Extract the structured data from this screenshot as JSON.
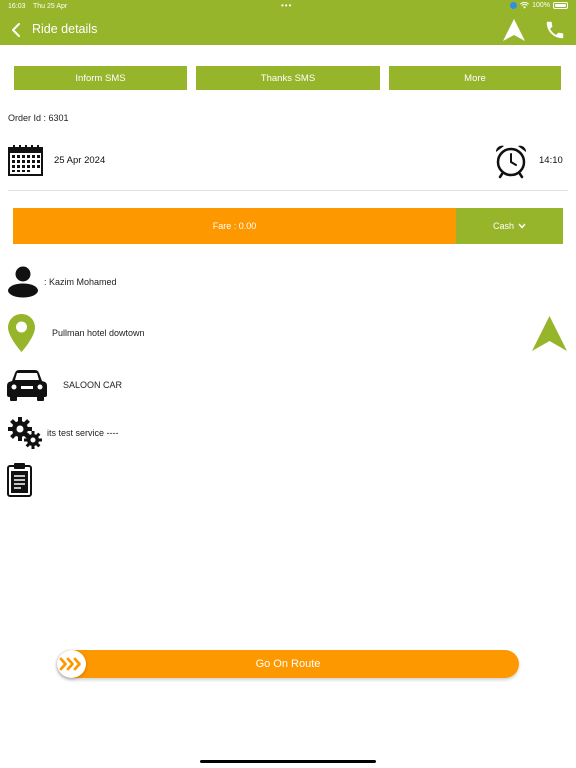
{
  "status_bar": {
    "time": "16:03",
    "date": "Thu 25 Apr",
    "battery": "100%"
  },
  "header": {
    "title": "Ride details"
  },
  "actions": {
    "inform_sms": "Inform SMS",
    "thanks_sms": "Thanks SMS",
    "more": "More"
  },
  "order": {
    "id_label": "Order Id : 6301"
  },
  "schedule": {
    "date": "25 Apr 2024",
    "time": "14:10"
  },
  "fare": {
    "label": "Fare : 0.00",
    "payment_method": "Cash"
  },
  "details": {
    "customer": ": Kazim Mohamed",
    "location": "Pullman hotel dowtown",
    "car_type": "SALOON CAR",
    "service": "its test service ----"
  },
  "footer": {
    "go_button": "Go On Route"
  },
  "colors": {
    "primary_green": "#97b52b",
    "accent_orange": "#fe9800"
  },
  "icons": [
    "back-icon",
    "navigation-arrow-icon",
    "phone-icon",
    "calendar-icon",
    "alarm-clock-icon",
    "chevron-down-icon",
    "person-icon",
    "location-pin-icon",
    "car-icon",
    "gears-icon",
    "clipboard-icon",
    "forward-chevrons-icon"
  ]
}
